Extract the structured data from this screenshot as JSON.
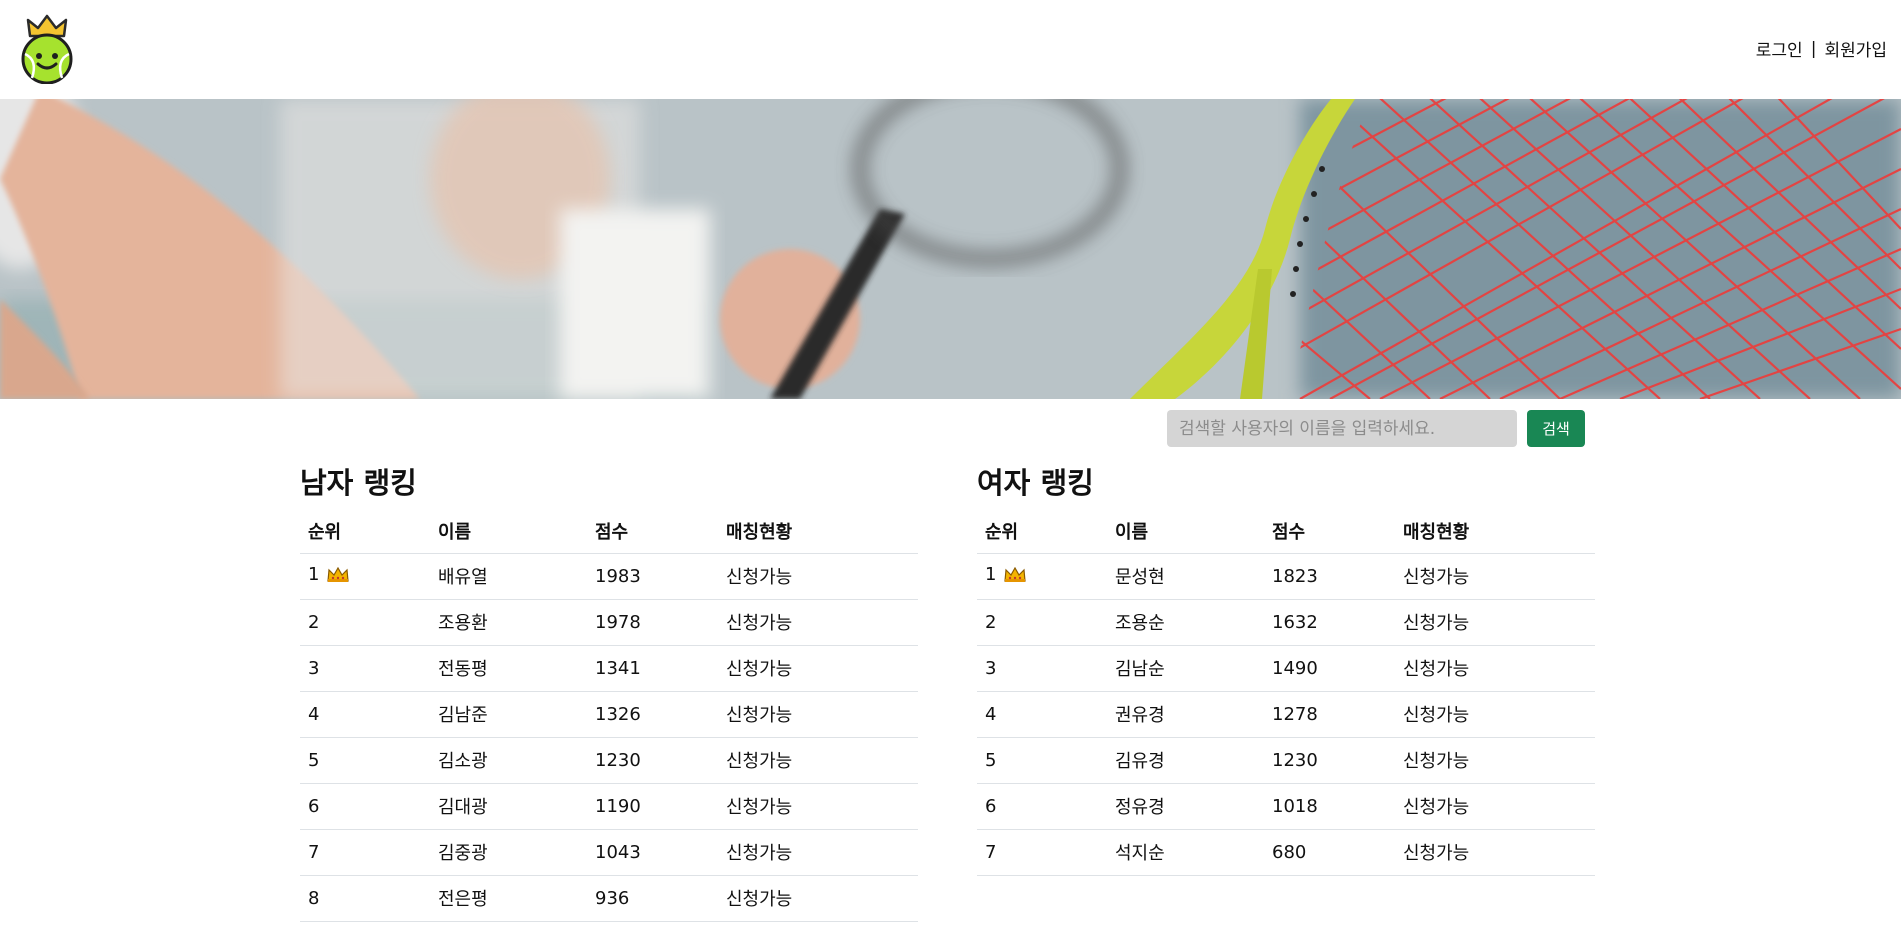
{
  "header": {
    "logo_icon": "tennis-ball-crown-logo",
    "login_label": "로그인",
    "separator": "|",
    "signup_label": "회원가입"
  },
  "banner": {
    "image": "tennis-racket-banner"
  },
  "search": {
    "placeholder": "검색할 사용자의 이름을 입력하세요.",
    "button_label": "검색"
  },
  "colors": {
    "accent": "#198754",
    "input_bg": "#d5d5d5",
    "racket": "#c7d63a",
    "strings": "#e8403f"
  },
  "men": {
    "title": "남자 랭킹",
    "columns": [
      "순위",
      "이름",
      "점수",
      "매칭현황"
    ],
    "rows": [
      {
        "rank": "1",
        "crown": true,
        "name": "배유열",
        "score": "1983",
        "status": "신청가능"
      },
      {
        "rank": "2",
        "name": "조용환",
        "score": "1978",
        "status": "신청가능"
      },
      {
        "rank": "3",
        "name": "전동평",
        "score": "1341",
        "status": "신청가능"
      },
      {
        "rank": "4",
        "name": "김남준",
        "score": "1326",
        "status": "신청가능"
      },
      {
        "rank": "5",
        "name": "김소광",
        "score": "1230",
        "status": "신청가능"
      },
      {
        "rank": "6",
        "name": "김대광",
        "score": "1190",
        "status": "신청가능"
      },
      {
        "rank": "7",
        "name": "김중광",
        "score": "1043",
        "status": "신청가능"
      },
      {
        "rank": "8",
        "name": "전은평",
        "score": "936",
        "status": "신청가능"
      }
    ]
  },
  "women": {
    "title": "여자 랭킹",
    "columns": [
      "순위",
      "이름",
      "점수",
      "매칭현황"
    ],
    "rows": [
      {
        "rank": "1",
        "crown": true,
        "name": "문성현",
        "score": "1823",
        "status": "신청가능"
      },
      {
        "rank": "2",
        "name": "조용순",
        "score": "1632",
        "status": "신청가능"
      },
      {
        "rank": "3",
        "name": "김남순",
        "score": "1490",
        "status": "신청가능"
      },
      {
        "rank": "4",
        "name": "권유경",
        "score": "1278",
        "status": "신청가능"
      },
      {
        "rank": "5",
        "name": "김유경",
        "score": "1230",
        "status": "신청가능"
      },
      {
        "rank": "6",
        "name": "정유경",
        "score": "1018",
        "status": "신청가능"
      },
      {
        "rank": "7",
        "name": "석지순",
        "score": "680",
        "status": "신청가능"
      }
    ]
  }
}
